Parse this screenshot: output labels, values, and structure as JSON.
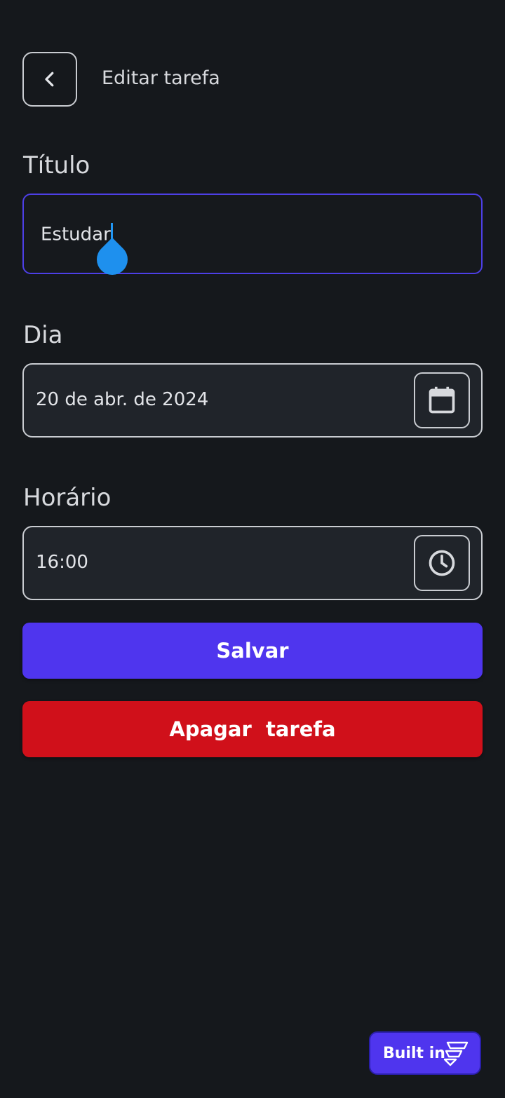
{
  "header": {
    "title": "Editar tarefa"
  },
  "form": {
    "title_label": "Título",
    "title_value": "Estudar",
    "day_label": "Dia",
    "day_value": "20 de abr. de 2024",
    "time_label": "Horário",
    "time_value": "16:00"
  },
  "actions": {
    "save_label": "Salvar",
    "delete_label": "Apagar  tarefa"
  },
  "badge": {
    "label": "Built in"
  },
  "icons": {
    "back": "chevron-left-icon",
    "calendar": "calendar-icon",
    "clock": "clock-icon",
    "logo": "flutterflow-logo"
  },
  "colors": {
    "background": "#15181c",
    "primary": "#4f35ee",
    "danger": "#d0101a",
    "focus_border": "#4d3fe6",
    "caret": "#2196f3"
  }
}
